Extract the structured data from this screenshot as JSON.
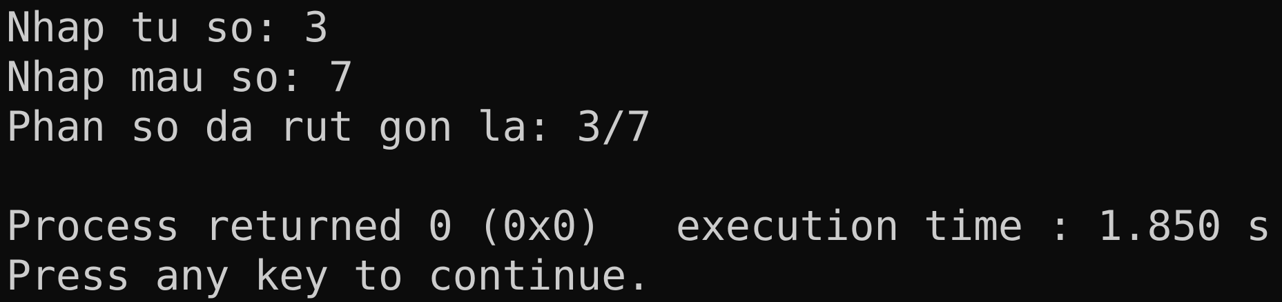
{
  "console": {
    "background": "#0c0c0c",
    "foreground": "#cccccc",
    "lines": [
      "Nhap tu so: 3",
      "Nhap mau so: 7",
      "Phan so da rut gon la: 3/7",
      "",
      "Process returned 0 (0x0)   execution time : 1.850 s",
      "Press any key to continue."
    ]
  }
}
